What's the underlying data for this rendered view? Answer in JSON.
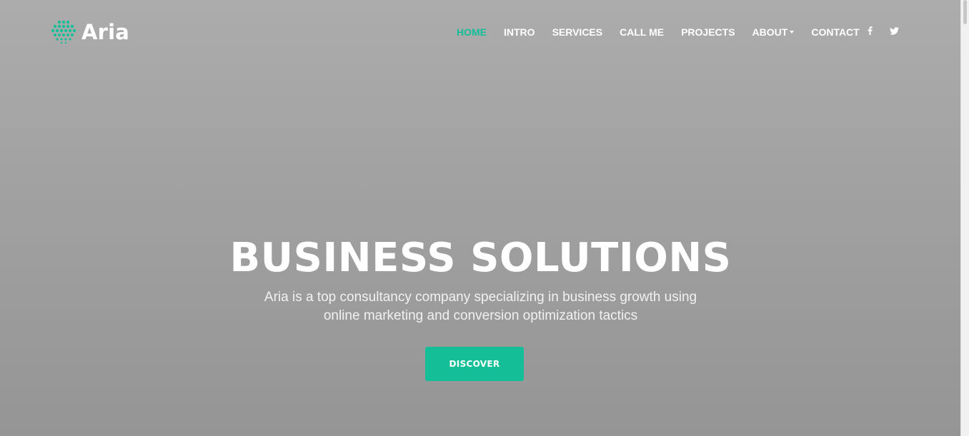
{
  "brand": {
    "name": "Aria",
    "icon": "aria-dots-logo-icon",
    "accent_color": "#14bf98"
  },
  "nav": {
    "items": [
      {
        "label": "HOME",
        "active": true
      },
      {
        "label": "INTRO",
        "active": false
      },
      {
        "label": "SERVICES",
        "active": false
      },
      {
        "label": "CALL ME",
        "active": false
      },
      {
        "label": "PROJECTS",
        "active": false
      },
      {
        "label": "ABOUT",
        "active": false,
        "dropdown": true
      },
      {
        "label": "CONTACT",
        "active": false
      }
    ],
    "social": [
      {
        "icon": "facebook-icon"
      },
      {
        "icon": "twitter-icon"
      }
    ]
  },
  "hero": {
    "title": "BUSINESS SOLUTIONS",
    "subtitle_line1": "Aria is a top consultancy company specializing in business growth using",
    "subtitle_line2": "online marketing and conversion optimization tactics",
    "button_label": "DISCOVER"
  }
}
